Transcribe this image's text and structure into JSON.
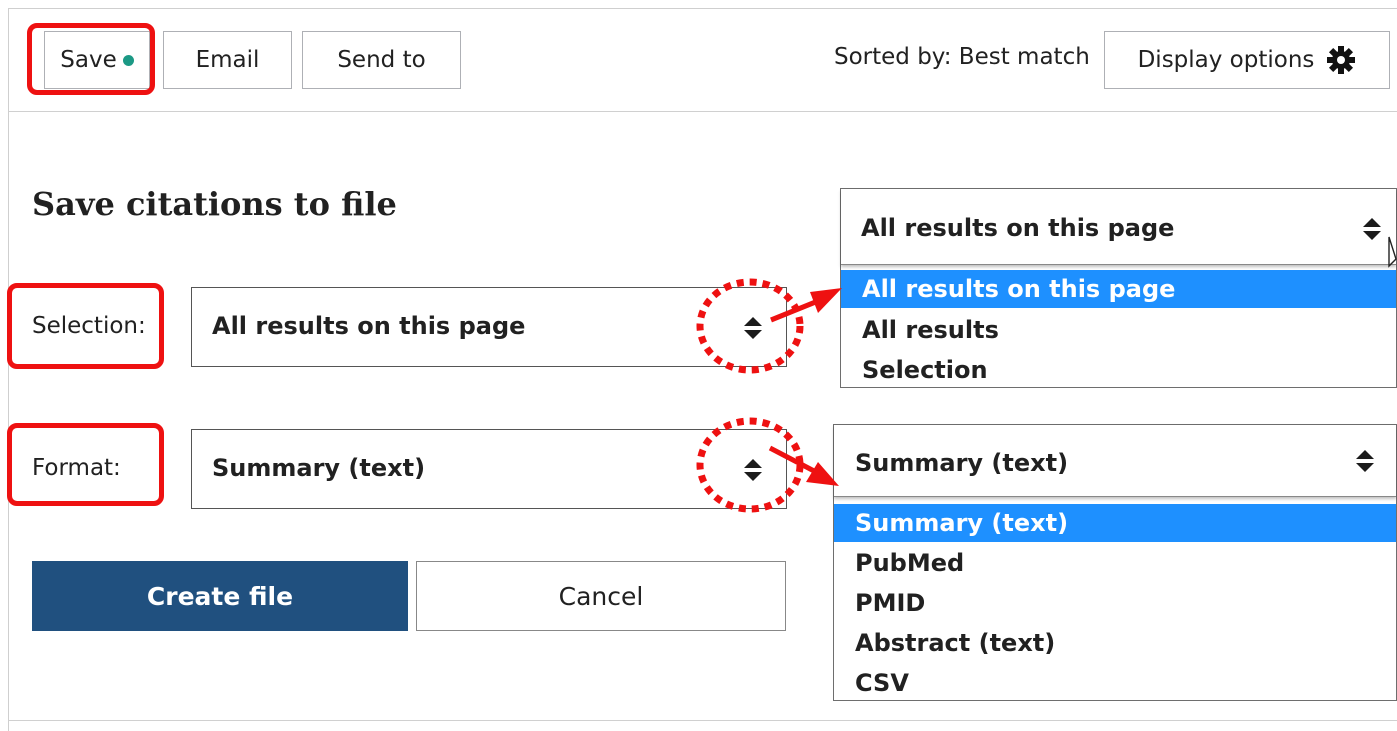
{
  "toolbar": {
    "save_label": "Save",
    "email_label": "Email",
    "send_to_label": "Send to",
    "sorted_by": "Sorted by: Best match",
    "display_options_label": "Display options"
  },
  "form": {
    "title": "Save citations to file",
    "selection_label": "Selection:",
    "selection_value": "All results on this page",
    "format_label": "Format:",
    "format_value": "Summary (text)",
    "create_file_label": "Create file",
    "cancel_label": "Cancel"
  },
  "selection_dropdown": {
    "current": "All results on this page",
    "options": [
      "All results on this page",
      "All results",
      "Selection"
    ],
    "highlighted_index": 0
  },
  "format_dropdown": {
    "current": "Summary (text)",
    "options": [
      "Summary (text)",
      "PubMed",
      "PMID",
      "Abstract (text)",
      "CSV"
    ],
    "highlighted_index": 0
  },
  "colors": {
    "status_dot": "#1b9985",
    "primary_button": "#20507f",
    "highlight": "#1e90ff",
    "annotation": "#ee1111"
  },
  "icons": {
    "display_options": "gear-icon",
    "select_caret": "up-down-caret-icon"
  }
}
